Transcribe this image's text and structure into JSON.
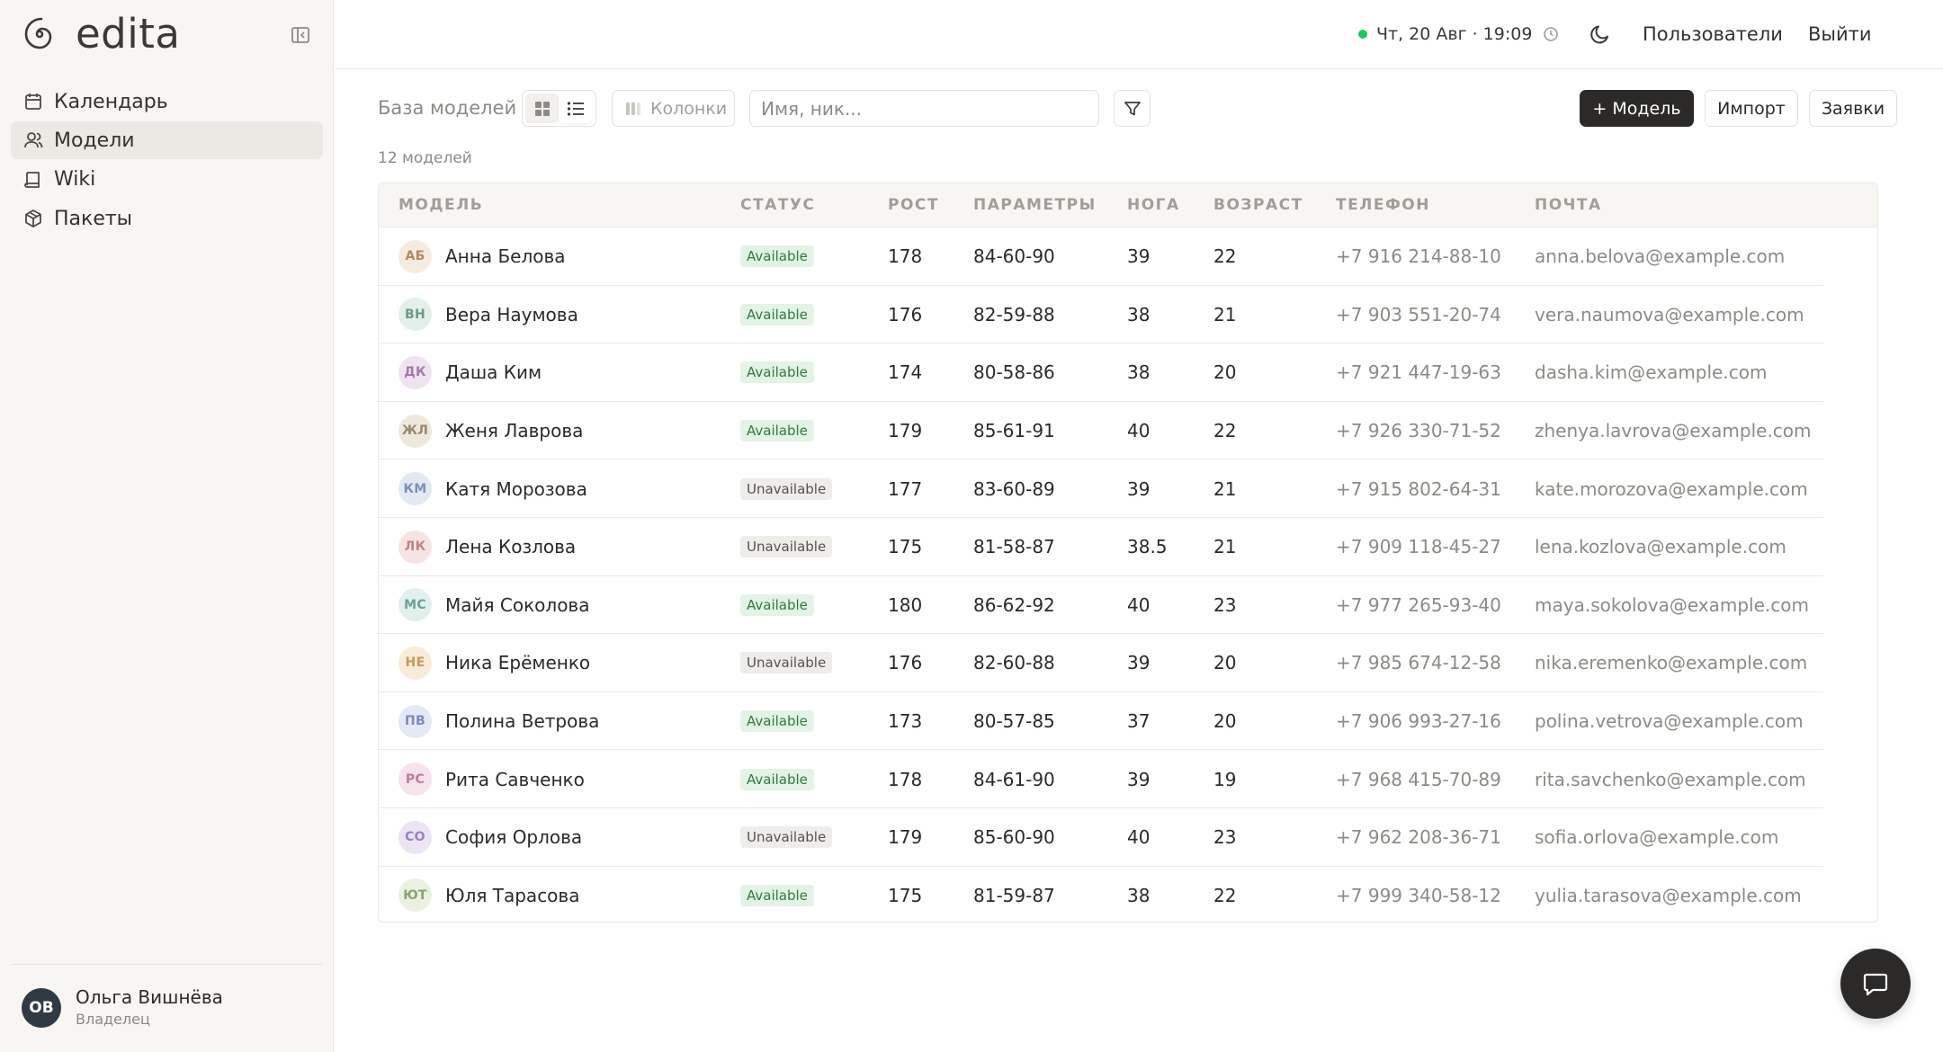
{
  "app": {
    "name": "edita"
  },
  "sidebar": {
    "items": [
      {
        "label": "Календарь",
        "icon": "calendar-icon",
        "active": false
      },
      {
        "label": "Модели",
        "icon": "users-icon",
        "active": true
      },
      {
        "label": "Wiki",
        "icon": "book-icon",
        "active": false
      },
      {
        "label": "Пакеты",
        "icon": "package-icon",
        "active": false
      }
    ],
    "user": {
      "initials": "ОВ",
      "name": "Ольга Вишнёва",
      "role": "Владелец"
    }
  },
  "topbar": {
    "datetime": "Чт, 20 Авг · 19:09",
    "status_color": "#22c55e",
    "users_link": "Пользователи",
    "logout_link": "Выйти"
  },
  "toolbar": {
    "title": "База моделей",
    "columns_label": "Колонки",
    "search_placeholder": "Имя, ник...",
    "search_value": "",
    "add_label": "+ Модель",
    "import_label": "Импорт",
    "requests_label": "Заявки"
  },
  "count_label": "12 моделей",
  "table": {
    "columns": [
      "МОДЕЛЬ",
      "СТАТУС",
      "РОСТ",
      "ПАРАМЕТРЫ",
      "НОГА",
      "ВОЗРАСТ",
      "ТЕЛЕФОН",
      "ПОЧТА"
    ],
    "rows": [
      {
        "initials": "АБ",
        "avatar_bg": "#f5ece0",
        "avatar_fg": "#b08a5e",
        "name": "Анна Белова",
        "status": "Available",
        "height": "178",
        "params": "84-60-90",
        "foot": "39",
        "age": "22",
        "phone": "+7 916 214-88-10",
        "email": "anna.belova@example.com"
      },
      {
        "initials": "ВН",
        "avatar_bg": "#e3efe9",
        "avatar_fg": "#6a9b84",
        "name": "Вера Наумова",
        "status": "Available",
        "height": "176",
        "params": "82-59-88",
        "foot": "38",
        "age": "21",
        "phone": "+7 903 551-20-74",
        "email": "vera.naumova@example.com"
      },
      {
        "initials": "ДК",
        "avatar_bg": "#efe3f0",
        "avatar_fg": "#a678ad",
        "name": "Даша Ким",
        "status": "Available",
        "height": "174",
        "params": "80-58-86",
        "foot": "38",
        "age": "20",
        "phone": "+7 921 447-19-63",
        "email": "dasha.kim@example.com"
      },
      {
        "initials": "ЖЛ",
        "avatar_bg": "#eee8dc",
        "avatar_fg": "#9a8a6c",
        "name": "Женя Лаврова",
        "status": "Available",
        "height": "179",
        "params": "85-61-91",
        "foot": "40",
        "age": "22",
        "phone": "+7 926 330-71-52",
        "email": "zhenya.lavrova@example.com"
      },
      {
        "initials": "КМ",
        "avatar_bg": "#e3e9f3",
        "avatar_fg": "#7c90b8",
        "name": "Катя Морозова",
        "status": "Unavailable",
        "height": "177",
        "params": "83-60-89",
        "foot": "39",
        "age": "21",
        "phone": "+7 915 802-64-31",
        "email": "kate.morozova@example.com"
      },
      {
        "initials": "ЛК",
        "avatar_bg": "#f6e4e4",
        "avatar_fg": "#c28080",
        "name": "Лена Козлова",
        "status": "Unavailable",
        "height": "175",
        "params": "81-58-87",
        "foot": "38.5",
        "age": "21",
        "phone": "+7 909 118-45-27",
        "email": "lena.kozlova@example.com"
      },
      {
        "initials": "МС",
        "avatar_bg": "#e1f0ec",
        "avatar_fg": "#6aa393",
        "name": "Майя Соколова",
        "status": "Available",
        "height": "180",
        "params": "86-62-92",
        "foot": "40",
        "age": "23",
        "phone": "+7 977 265-93-40",
        "email": "maya.sokolova@example.com"
      },
      {
        "initials": "НЕ",
        "avatar_bg": "#f8ecd9",
        "avatar_fg": "#c59a55",
        "name": "Ника Ерёменко",
        "status": "Unavailable",
        "height": "176",
        "params": "82-60-88",
        "foot": "39",
        "age": "20",
        "phone": "+7 985 674-12-58",
        "email": "nika.eremenko@example.com"
      },
      {
        "initials": "ПВ",
        "avatar_bg": "#e5e8f5",
        "avatar_fg": "#8088bb",
        "name": "Полина Ветрова",
        "status": "Available",
        "height": "173",
        "params": "80-57-85",
        "foot": "37",
        "age": "20",
        "phone": "+7 906 993-27-16",
        "email": "polina.vetrova@example.com"
      },
      {
        "initials": "РС",
        "avatar_bg": "#f6e3ec",
        "avatar_fg": "#c07b9b",
        "name": "Рита Савченко",
        "status": "Available",
        "height": "178",
        "params": "84-61-90",
        "foot": "39",
        "age": "19",
        "phone": "+7 968 415-70-89",
        "email": "rita.savchenko@example.com"
      },
      {
        "initials": "СО",
        "avatar_bg": "#ece4f5",
        "avatar_fg": "#9b80c2",
        "name": "София Орлова",
        "status": "Unavailable",
        "height": "179",
        "params": "85-60-90",
        "foot": "40",
        "age": "23",
        "phone": "+7 962 208-36-71",
        "email": "sofia.orlova@example.com"
      },
      {
        "initials": "ЮТ",
        "avatar_bg": "#eaf1e1",
        "avatar_fg": "#8aa46a",
        "name": "Юля Тарасова",
        "status": "Available",
        "height": "175",
        "params": "81-59-87",
        "foot": "38",
        "age": "22",
        "phone": "+7 999 340-58-12",
        "email": "yulia.tarasova@example.com"
      }
    ]
  },
  "fab": {
    "icon": "chat-icon"
  }
}
